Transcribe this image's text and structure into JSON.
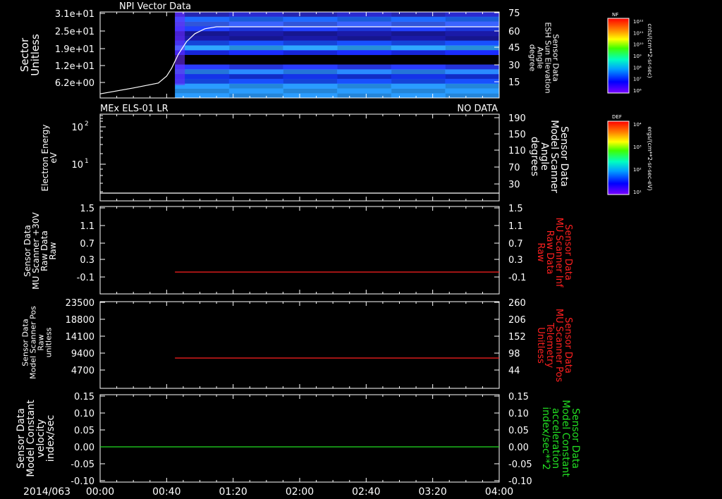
{
  "chart_data": [
    {
      "type": "heatmap",
      "title": "NPI Vector Data",
      "ylabel_lines": [
        "Sector",
        "Unitless"
      ],
      "y_ticks": [
        "3.1e+01",
        "2.5e+01",
        "1.9e+01",
        "1.2e+01",
        "6.2e+00"
      ],
      "right_ylabel_lines": [
        "Sensor Data",
        "ESH Sun Elevation",
        "Angle",
        "degree"
      ],
      "right_ticks": [
        "75",
        "60",
        "45",
        "30",
        "15"
      ],
      "colorbar": {
        "label": "NF",
        "units": "cnts/(cm**2-sr-sec)",
        "ticks": [
          "10¹²",
          "10¹¹",
          "10¹⁰",
          "10⁹",
          "10⁸",
          "10⁷",
          "10⁶"
        ]
      },
      "data_start_time": "00:45",
      "overlay_line": {
        "name": "ESH Sun Elevation Angle",
        "color": "#ffffff",
        "x": [
          "00:00",
          "00:20",
          "00:35",
          "00:40",
          "00:43",
          "00:47",
          "00:52",
          "00:57",
          "01:03",
          "01:10",
          "04:00"
        ],
        "y": [
          2,
          8,
          13,
          20,
          28,
          42,
          55,
          63,
          68,
          70,
          70
        ]
      }
    },
    {
      "type": "line",
      "title": "MEx ELS-01 LR",
      "status": "NO DATA",
      "ylabel_lines": [
        "Electron Energy",
        "eV"
      ],
      "y_ticks": [
        "10²",
        "10¹"
      ],
      "y_scale": "log",
      "right_ylabel_lines": [
        "Sensor Data",
        "Model Scanner",
        "Angle",
        "degrees"
      ],
      "right_ticks": [
        "190",
        "150",
        "110",
        "70",
        "30"
      ],
      "colorbar": {
        "label": "DEF",
        "units": "ergs/(cm**2-sr-sec-eV)",
        "ticks": [
          "10⁴",
          "10³",
          "10²",
          "10¹"
        ]
      },
      "series": [
        {
          "color": "#ffffff",
          "x": [
            "00:00",
            "04:00"
          ],
          "y": [
            10,
            10
          ]
        }
      ],
      "ylim_right": [
        10,
        190
      ]
    },
    {
      "type": "line",
      "ylabel_lines": [
        "Sensor Data",
        "MU Scanner +30V",
        "Raw Data",
        "Raw"
      ],
      "y_ticks": [
        "1.5",
        "1.1",
        "0.7",
        "0.3",
        "-0.1"
      ],
      "right_ylabel_lines": [
        "Sensor Data",
        "MU Scanner Inf",
        "Raw Data",
        "Raw"
      ],
      "right_ticks": [
        "1.5",
        "1.1",
        "0.7",
        "0.3",
        "-0.1"
      ],
      "ylim": [
        -0.3,
        1.5
      ],
      "series": [
        {
          "color": "#ff2020",
          "x": [
            "00:45",
            "04:00"
          ],
          "y": [
            0,
            0
          ]
        }
      ]
    },
    {
      "type": "line",
      "ylabel_lines": [
        "Sensor Data",
        "Model Scanner Pos",
        "Raw",
        "unitless"
      ],
      "y_ticks": [
        "23500",
        "18800",
        "14100",
        "9400",
        "4700"
      ],
      "right_ylabel_lines": [
        "Sensor Data",
        "MU Scanner Pos",
        "Telemetry",
        "Unitless"
      ],
      "right_ticks": [
        "260",
        "206",
        "152",
        "98",
        "44"
      ],
      "ylim_right": [
        -10,
        260
      ],
      "series": [
        {
          "color": "#ff2020",
          "x": [
            "00:45",
            "04:00"
          ],
          "y": [
            90,
            90
          ]
        }
      ]
    },
    {
      "type": "line",
      "ylabel_lines": [
        "Sensor Data",
        "Model Constant",
        "velocity",
        "index/sec"
      ],
      "y_ticks": [
        "0.15",
        "0.10",
        "0.05",
        "0.00",
        "-0.05",
        "-0.10"
      ],
      "right_ylabel_lines": [
        "Sensor Data",
        "Model Constant",
        "acceleration",
        "index/sec**2"
      ],
      "right_ticks": [
        "0.15",
        "0.10",
        "0.05",
        "0.00",
        "-0.05",
        "-0.10"
      ],
      "ylim": [
        -0.1,
        0.15
      ],
      "series": [
        {
          "color": "#22dd22",
          "x": [
            "00:00",
            "04:00"
          ],
          "y": [
            0,
            0
          ]
        }
      ]
    }
  ],
  "time_axis": {
    "date_label": "2014/063",
    "ticks": [
      "00:00",
      "00:40",
      "01:20",
      "02:00",
      "02:40",
      "03:20",
      "04:00"
    ]
  },
  "colors": {
    "frame": "#ffffff",
    "background": "#000000",
    "red_label": "#ff2020",
    "green_label": "#22dd22"
  }
}
